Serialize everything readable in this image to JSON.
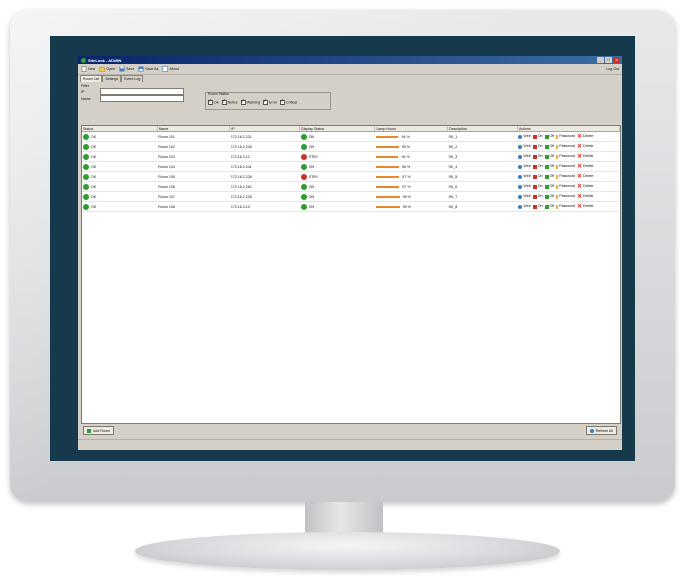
{
  "window": {
    "title": "SiteLook - ADMIN"
  },
  "toolbar": {
    "new": "New",
    "open": "Open",
    "save": "Save",
    "save_as": "Save As",
    "about": "About",
    "logout": "Log Out"
  },
  "tabs": [
    "Room List",
    "Settings",
    "Event Log"
  ],
  "filters": {
    "group_label": "Filter",
    "ip_label": "IP",
    "name_label": "Name",
    "room_status_label": "Room Status",
    "status_options": [
      "Ok",
      "Notice",
      "Warning",
      "Error",
      "Critical"
    ]
  },
  "table": {
    "headers": [
      "Status",
      "Name",
      "IP",
      "Display Status",
      "Lamp Hours",
      "Description",
      "Actions"
    ],
    "rows": [
      {
        "status": "OK",
        "status_color": "#2e9c2e",
        "name": "Room 101",
        "ip": "172.16.2.221",
        "display": "ON",
        "display_color": "#2e9c2e",
        "lamp_pct": 0.94,
        "lamp": "94 %",
        "desc": "SK_1"
      },
      {
        "status": "OK",
        "status_color": "#2e9c2e",
        "name": "Room 102",
        "ip": "172.16.2.245",
        "display": "ON",
        "display_color": "#2e9c2e",
        "lamp_pct": 0.95,
        "lamp": "95 %",
        "desc": "SK_2"
      },
      {
        "status": "OK",
        "status_color": "#2e9c2e",
        "name": "Room 103",
        "ip": "172.16.3.12",
        "display": "STBY",
        "display_color": "#c9332a",
        "lamp_pct": 0.94,
        "lamp": "94 %",
        "desc": "SK_3"
      },
      {
        "status": "OK",
        "status_color": "#2e9c2e",
        "name": "Room 104",
        "ip": "172.16.2.241",
        "display": "ON",
        "display_color": "#2e9c2e",
        "lamp_pct": 0.96,
        "lamp": "96 %",
        "desc": "SK_4"
      },
      {
        "status": "OK",
        "status_color": "#2e9c2e",
        "name": "Room 105",
        "ip": "172.16.2.226",
        "display": "STBY",
        "display_color": "#c9332a",
        "lamp_pct": 0.97,
        "lamp": "97 %",
        "desc": "SK_5"
      },
      {
        "status": "OK",
        "status_color": "#2e9c2e",
        "name": "Room 106",
        "ip": "172.16.2.262",
        "display": "ON",
        "display_color": "#2e9c2e",
        "lamp_pct": 0.97,
        "lamp": "97 %",
        "desc": "SK_6"
      },
      {
        "status": "OK",
        "status_color": "#2e9c2e",
        "name": "Room 107",
        "ip": "172.16.2.226",
        "display": "ON",
        "display_color": "#2e9c2e",
        "lamp_pct": 0.99,
        "lamp": "99 %",
        "desc": "SK_7"
      },
      {
        "status": "OK",
        "status_color": "#2e9c2e",
        "name": "Room 108",
        "ip": "172.16.3.13",
        "display": "ON",
        "display_color": "#2e9c2e",
        "lamp_pct": 0.99,
        "lamp": "99 %",
        "desc": "SK_8"
      }
    ],
    "actions": {
      "web": "Web",
      "on": "On",
      "off": "Off",
      "password": "Password",
      "delete": "Delete"
    }
  },
  "bottom": {
    "add_room": "Add Room",
    "refresh_all": "Refresh All"
  },
  "colors": {
    "bezel": "#163a4c",
    "titlebar": "#0a246a",
    "lamp_bar": "#e58a2a"
  }
}
